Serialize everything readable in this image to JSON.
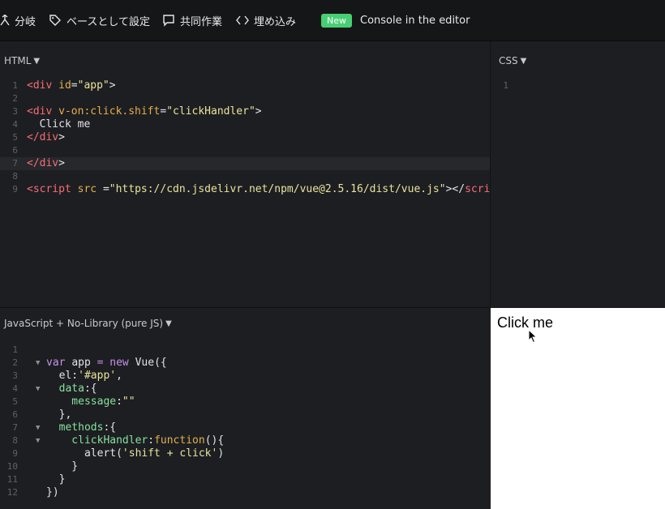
{
  "topbar": {
    "fork_label": "分岐",
    "base_label": "ベースとして設定",
    "collab_label": "共同作業",
    "embed_label": "埋め込み",
    "new_badge": "New",
    "console_label": "Console in the editor"
  },
  "html_pane": {
    "title": "HTML",
    "lines": [
      {
        "n": "1",
        "parts": [
          [
            "tag",
            "<div "
          ],
          [
            "attr",
            "id"
          ],
          [
            "plain",
            "="
          ],
          [
            "str",
            "\"app\""
          ],
          [
            "plain",
            ">"
          ]
        ]
      },
      {
        "n": "2",
        "parts": []
      },
      {
        "n": "3",
        "parts": [
          [
            "tag",
            "<div "
          ],
          [
            "attr",
            "v-on:click.shift"
          ],
          [
            "plain",
            "="
          ],
          [
            "str",
            "\"clickHandler\""
          ],
          [
            "plain",
            ">"
          ]
        ]
      },
      {
        "n": "4",
        "parts": [
          [
            "plain",
            "  Click me"
          ]
        ]
      },
      {
        "n": "5",
        "parts": [
          [
            "tag",
            "</div"
          ],
          [
            "plain",
            ">"
          ]
        ]
      },
      {
        "n": "6",
        "parts": []
      },
      {
        "n": "7",
        "parts": [
          [
            "tag",
            "</div"
          ],
          [
            "plain",
            ">"
          ]
        ]
      },
      {
        "n": "8",
        "parts": []
      },
      {
        "n": "9",
        "parts": [
          [
            "tag",
            "<script "
          ],
          [
            "attr",
            "src "
          ],
          [
            "plain",
            "="
          ],
          [
            "str",
            "\"https://cdn.jsdelivr.net/npm/vue@2.5.16/dist/vue.js\""
          ],
          [
            "plain",
            "></"
          ],
          [
            "tag",
            "script"
          ],
          [
            "plain",
            ">"
          ]
        ]
      }
    ]
  },
  "css_pane": {
    "title": "CSS",
    "lines": [
      {
        "n": "1",
        "parts": []
      }
    ]
  },
  "js_pane": {
    "title": "JavaScript + No-Library (pure JS)",
    "lines": [
      {
        "n": "1",
        "fold": false,
        "parts": []
      },
      {
        "n": "2",
        "fold": true,
        "parts": [
          [
            "kw",
            "var "
          ],
          [
            "plain",
            "app "
          ],
          [
            "kw",
            "= new "
          ],
          [
            "plain",
            "Vue({"
          ]
        ]
      },
      {
        "n": "3",
        "fold": false,
        "parts": [
          [
            "plain",
            "  el:"
          ],
          [
            "str",
            "'#app'"
          ],
          [
            "plain",
            ","
          ]
        ]
      },
      {
        "n": "4",
        "fold": true,
        "parts": [
          [
            "prop",
            "  data"
          ],
          [
            "plain",
            ":{"
          ]
        ]
      },
      {
        "n": "5",
        "fold": false,
        "parts": [
          [
            "prop",
            "    message"
          ],
          [
            "plain",
            ":"
          ],
          [
            "str",
            "\"\""
          ]
        ]
      },
      {
        "n": "6",
        "fold": false,
        "parts": [
          [
            "plain",
            "  },"
          ]
        ]
      },
      {
        "n": "7",
        "fold": true,
        "parts": [
          [
            "prop",
            "  methods"
          ],
          [
            "plain",
            ":{"
          ]
        ]
      },
      {
        "n": "8",
        "fold": true,
        "parts": [
          [
            "prop",
            "    clickHandler"
          ],
          [
            "plain",
            ":"
          ],
          [
            "fn",
            "function"
          ],
          [
            "plain",
            "(){"
          ]
        ]
      },
      {
        "n": "9",
        "fold": false,
        "parts": [
          [
            "plain",
            "      alert("
          ],
          [
            "str",
            "'shift + click'"
          ],
          [
            "plain",
            ")"
          ]
        ]
      },
      {
        "n": "10",
        "fold": false,
        "parts": [
          [
            "plain",
            "    }"
          ]
        ]
      },
      {
        "n": "11",
        "fold": false,
        "parts": [
          [
            "plain",
            "  }"
          ]
        ]
      },
      {
        "n": "12",
        "fold": false,
        "parts": [
          [
            "plain",
            "})"
          ]
        ]
      }
    ]
  },
  "preview": {
    "text": "Click me"
  }
}
